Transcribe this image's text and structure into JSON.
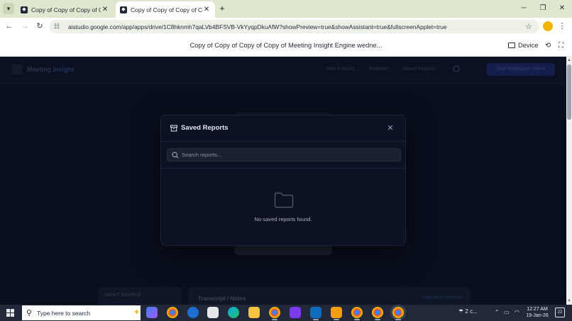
{
  "browser": {
    "tabs": [
      {
        "title": "Copy of Copy of Copy of Copy"
      },
      {
        "title": "Copy of Copy of Copy of Copy"
      }
    ],
    "new_tab": "+",
    "url": "aistudio.google.com/app/apps/drive/1C8hknmh7qaLVb4BFSVB-VkYyqpDkuAfW?showPreview=true&showAssistant=true&fullscreenApplet=true"
  },
  "applet": {
    "title": "Copy of Copy of Copy of Copy of Meeting Insight Engine wedne...",
    "device_label": "Device"
  },
  "background_app": {
    "brand": "Meeting",
    "brand_accent": "Insight",
    "nav_links": [
      "How it Works",
      "Features",
      "Saved Reports"
    ],
    "cta": "Start Enterprise Demo",
    "left_card_label": "INPUT SOURCE",
    "right_card_title": "Transcript / Notes",
    "right_card_link": "Load demo transcript"
  },
  "modal": {
    "title": "Saved Reports",
    "search_placeholder": "Search reports...",
    "search_value": "",
    "empty_message": "No saved reports found."
  },
  "taskbar": {
    "search_placeholder": "Type here to search",
    "weather": "2 c...",
    "time": "12:27 AM",
    "date": "19-Jan-26",
    "notifications": "22"
  },
  "colors": {
    "viewport_bg": "#0a0f1e",
    "modal_bg": "#0c1223",
    "accent": "#1e2a6e"
  }
}
